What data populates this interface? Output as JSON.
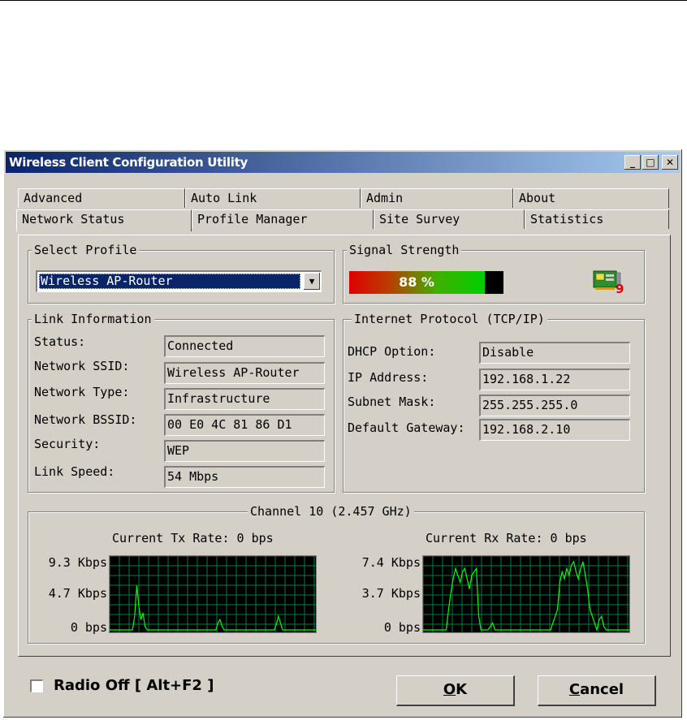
{
  "window": {
    "title": "Wireless Client Configuration Utility",
    "minimize_glyph": "_",
    "maximize_glyph": "□",
    "close_glyph": "✕"
  },
  "tabs": {
    "back_row": [
      "Advanced",
      "Auto Link",
      "Admin",
      "About"
    ],
    "front_row": [
      "Network Status",
      "Profile Manager",
      "Site Survey",
      "Statistics"
    ],
    "active": "Network Status"
  },
  "profile": {
    "legend": "Select Profile",
    "selected": "Wireless AP-Router",
    "dropdown_glyph": "▼"
  },
  "signal": {
    "legend": "Signal Strength",
    "percent_text": "88 %",
    "level": 0.88,
    "adapter_icon": "network-card-icon",
    "adapter_badge": "9"
  },
  "link": {
    "legend": "Link Information",
    "rows": [
      {
        "label": "Status:",
        "value": "Connected"
      },
      {
        "label": "Network SSID:",
        "value": "Wireless AP-Router"
      },
      {
        "label": "Network Type:",
        "value": "Infrastructure"
      },
      {
        "label": "Network BSSID:",
        "value": "00 E0 4C 81 86 D1"
      },
      {
        "label": "Security:",
        "value": "WEP"
      },
      {
        "label": "Link Speed:",
        "value": "54 Mbps"
      }
    ]
  },
  "tcpip": {
    "legend": "Internet Protocol (TCP/IP)",
    "rows": [
      {
        "label": "DHCP Option:",
        "value": "Disable"
      },
      {
        "label": "IP Address:",
        "value": "192.168.1.22"
      },
      {
        "label": "Subnet Mask:",
        "value": "255.255.255.0"
      },
      {
        "label": "Default Gateway:",
        "value": "192.168.2.10"
      }
    ]
  },
  "channel": {
    "legend": "Channel 10 (2.457 GHz)",
    "tx": {
      "title": "Current Tx Rate: 0 bps",
      "ticks": [
        "9.3 Kbps",
        "4.7 Kbps",
        "0 bps"
      ],
      "trace": [
        0,
        0,
        0,
        0,
        0,
        0,
        0,
        0,
        0,
        0,
        0,
        0,
        0.2,
        0.65,
        0.35,
        0.15,
        0.25,
        0.05,
        0,
        0,
        0,
        0,
        0,
        0,
        0,
        0,
        0,
        0,
        0,
        0,
        0,
        0,
        0,
        0,
        0,
        0,
        0,
        0,
        0,
        0,
        0,
        0,
        0,
        0,
        0,
        0,
        0,
        0,
        0,
        0,
        0,
        0,
        0.1,
        0.15,
        0.05,
        0,
        0,
        0,
        0,
        0,
        0,
        0,
        0,
        0,
        0,
        0,
        0,
        0,
        0,
        0,
        0,
        0,
        0,
        0,
        0,
        0,
        0,
        0,
        0,
        0,
        0.08,
        0.2,
        0.1,
        0,
        0,
        0,
        0,
        0,
        0,
        0,
        0,
        0,
        0,
        0,
        0,
        0,
        0,
        0,
        0,
        0
      ]
    },
    "rx": {
      "title": "Current Rx Rate: 0 bps",
      "ticks": [
        "7.4 Kbps",
        "3.7 Kbps",
        "0 bps"
      ],
      "trace": [
        0,
        0,
        0,
        0,
        0,
        0,
        0,
        0,
        0,
        0,
        0,
        0.3,
        0.55,
        0.75,
        0.9,
        0.8,
        0.7,
        0.85,
        0.9,
        0.75,
        0.6,
        0.8,
        0.85,
        0.9,
        0.2,
        0,
        0,
        0,
        0,
        0.05,
        0.1,
        0,
        0,
        0,
        0,
        0,
        0,
        0,
        0,
        0,
        0,
        0,
        0,
        0,
        0,
        0,
        0,
        0,
        0,
        0,
        0,
        0,
        0,
        0,
        0,
        0,
        0.1,
        0.2,
        0.3,
        0.7,
        0.85,
        0.75,
        0.9,
        0.8,
        0.95,
        1.0,
        0.85,
        0.75,
        0.9,
        1.0,
        0.8,
        0.6,
        0.3,
        0.2,
        0.1,
        0,
        0.15,
        0.2,
        0.05,
        0,
        0,
        0,
        0,
        0,
        0,
        0,
        0,
        0,
        0,
        0
      ]
    }
  },
  "footer": {
    "radio_label": "Radio Off  [ Alt+F2 ]",
    "radio_checked": false,
    "ok_mnemonic": "O",
    "ok_rest": "K",
    "cancel_mnemonic": "C",
    "cancel_rest": "ancel"
  }
}
